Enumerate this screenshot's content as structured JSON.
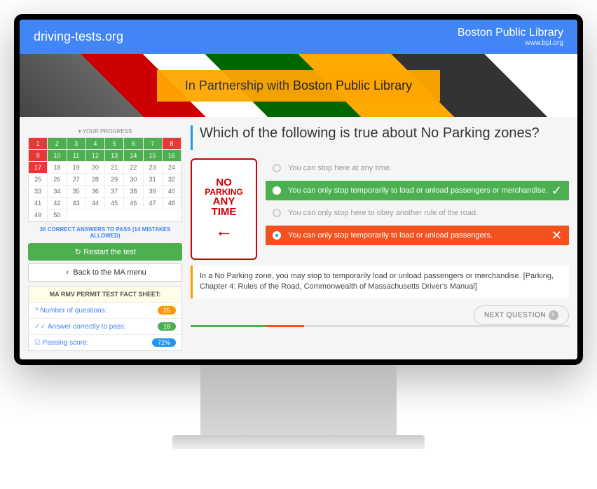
{
  "header": {
    "site": "driving-tests.org",
    "library": "Boston Public Library",
    "library_url": "www.bpl.org"
  },
  "banner": {
    "prefix": "In Partnership with ",
    "partner": "Boston Public Library"
  },
  "progress": {
    "label": "YOUR PROGRESS",
    "cells": [
      {
        "n": 1,
        "s": "red"
      },
      {
        "n": 2,
        "s": "green"
      },
      {
        "n": 3,
        "s": "green"
      },
      {
        "n": 4,
        "s": "green"
      },
      {
        "n": 5,
        "s": "green"
      },
      {
        "n": 6,
        "s": "green"
      },
      {
        "n": 7,
        "s": "green"
      },
      {
        "n": 8,
        "s": "red"
      },
      {
        "n": 9,
        "s": "red"
      },
      {
        "n": 10,
        "s": "green"
      },
      {
        "n": 11,
        "s": "green"
      },
      {
        "n": 12,
        "s": "green"
      },
      {
        "n": 13,
        "s": "green"
      },
      {
        "n": 14,
        "s": "green"
      },
      {
        "n": 15,
        "s": "green"
      },
      {
        "n": 16,
        "s": "green"
      },
      {
        "n": 17,
        "s": "red"
      },
      {
        "n": 18,
        "s": ""
      },
      {
        "n": 19,
        "s": ""
      },
      {
        "n": 20,
        "s": ""
      },
      {
        "n": 21,
        "s": ""
      },
      {
        "n": 22,
        "s": ""
      },
      {
        "n": 23,
        "s": ""
      },
      {
        "n": 24,
        "s": ""
      },
      {
        "n": 25,
        "s": ""
      },
      {
        "n": 26,
        "s": ""
      },
      {
        "n": 27,
        "s": ""
      },
      {
        "n": 28,
        "s": ""
      },
      {
        "n": 29,
        "s": ""
      },
      {
        "n": 30,
        "s": ""
      },
      {
        "n": 31,
        "s": ""
      },
      {
        "n": 32,
        "s": ""
      },
      {
        "n": 33,
        "s": ""
      },
      {
        "n": 34,
        "s": ""
      },
      {
        "n": 35,
        "s": ""
      },
      {
        "n": 36,
        "s": ""
      },
      {
        "n": 37,
        "s": ""
      },
      {
        "n": 38,
        "s": ""
      },
      {
        "n": 39,
        "s": ""
      },
      {
        "n": 40,
        "s": ""
      },
      {
        "n": 41,
        "s": ""
      },
      {
        "n": 42,
        "s": ""
      },
      {
        "n": 43,
        "s": ""
      },
      {
        "n": 44,
        "s": ""
      },
      {
        "n": 45,
        "s": ""
      },
      {
        "n": 46,
        "s": ""
      },
      {
        "n": 47,
        "s": ""
      },
      {
        "n": 48,
        "s": ""
      },
      {
        "n": 49,
        "s": ""
      },
      {
        "n": 50,
        "s": ""
      }
    ],
    "pass_note": "36 CORRECT ANSWERS TO PASS (14 MISTAKES ALLOWED)",
    "restart": "Restart the test",
    "back": "Back to the MA menu"
  },
  "facts": {
    "title": "MA RMV PERMIT TEST FACT SHEET:",
    "rows": [
      {
        "label": "Number of questions:",
        "value": "25",
        "cls": "badge-orange"
      },
      {
        "label": "Answer correctly to pass:",
        "value": "18",
        "cls": "badge-green"
      },
      {
        "label": "Passing score:",
        "value": "72%",
        "cls": "badge-blue"
      }
    ]
  },
  "question": {
    "text": "Which of the following is true about No Parking zones?",
    "sign": {
      "l1": "NO",
      "l2": "PARKING",
      "l3": "ANY",
      "l4": "TIME"
    },
    "answers": [
      {
        "text": "You can stop here at any time.",
        "state": "plain"
      },
      {
        "text": "You can only stop temporarily to load or unload passengers or merchandise.",
        "state": "correct"
      },
      {
        "text": "You can only stop here to obey another rule of the road.",
        "state": "plain"
      },
      {
        "text": "You can only stop temporarily to load or unload passengers.",
        "state": "wrong"
      }
    ],
    "explanation": "In a No Parking zone, you may stop to temporarily load or unload passengers or merchandise. [Parking, Chapter 4: Rules of the Road, Commonwealth of Massachusetts Driver's Manual]",
    "next": "NEXT QUESTION"
  },
  "progbar_colors": [
    "#4caf50",
    "#4caf50",
    "#f4511e",
    "#ddd",
    "#ddd",
    "#ddd",
    "#ddd",
    "#ddd",
    "#ddd",
    "#ddd"
  ]
}
